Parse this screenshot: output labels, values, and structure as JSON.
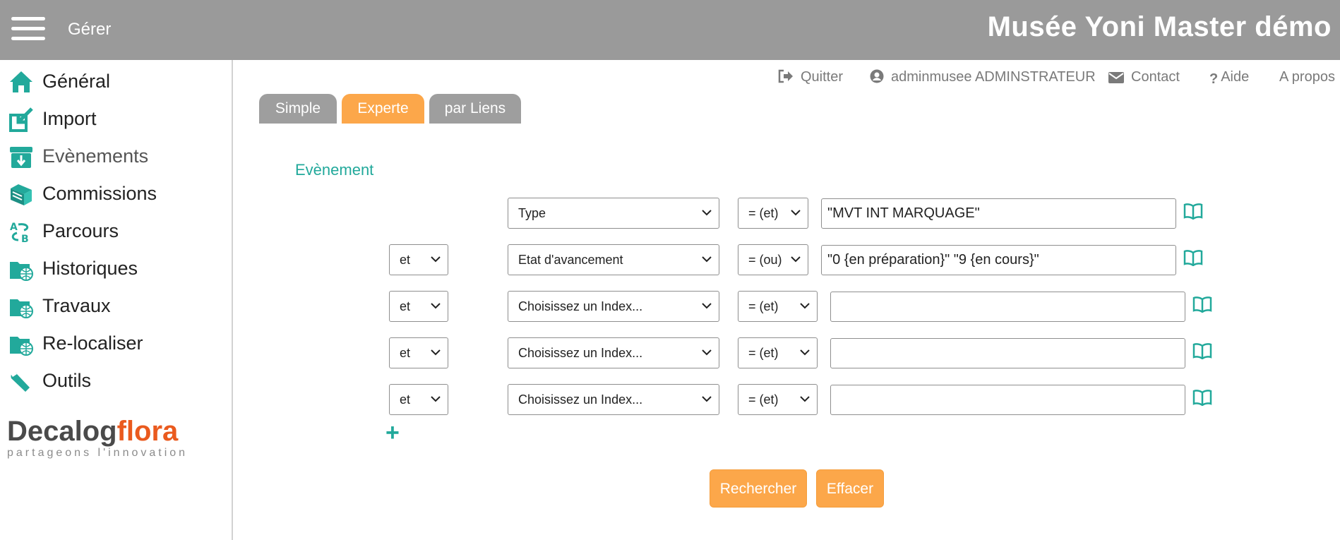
{
  "header": {
    "manage_label": "Gérer",
    "title": "Musée Yoni Master démo"
  },
  "sidebar": {
    "items": [
      {
        "label": "Général",
        "icon": "home-icon"
      },
      {
        "label": "Import",
        "icon": "import-icon"
      },
      {
        "label": "Evènements",
        "icon": "event-archive-icon"
      },
      {
        "label": "Commissions",
        "icon": "books-icon"
      },
      {
        "label": "Parcours",
        "icon": "route-icon"
      },
      {
        "label": "Historiques",
        "icon": "globe-folder-icon"
      },
      {
        "label": "Travaux",
        "icon": "globe-folder-icon"
      },
      {
        "label": "Re-localiser",
        "icon": "globe-folder-icon"
      },
      {
        "label": "Outils",
        "icon": "wrench-icon"
      }
    ],
    "brand": {
      "decalog": "Decalog",
      "flora": "flora",
      "tagline": "partageons l'innovation"
    }
  },
  "toplinks": {
    "quit": "Quitter",
    "user": "adminmusee ADMINSTRATEUR",
    "contact": "Contact",
    "help": "Aide",
    "about": "A propos"
  },
  "tabs": [
    {
      "label": "Simple",
      "active": false
    },
    {
      "label": "Experte",
      "active": true
    },
    {
      "label": "par Liens",
      "active": false
    }
  ],
  "section": {
    "label": "Evènement"
  },
  "criteria": [
    {
      "connector": "",
      "field": "Type",
      "operator": "= (et)",
      "value": "\"MVT INT MARQUAGE\""
    },
    {
      "connector": "et",
      "field": "Etat d'avancement",
      "operator": "= (ou)",
      "value": "\"0 {en préparation}\" \"9 {en cours}\""
    },
    {
      "connector": "et",
      "field": "Choisissez un Index...",
      "operator": "= (et)",
      "value": ""
    },
    {
      "connector": "et",
      "field": "Choisissez un Index...",
      "operator": "= (et)",
      "value": ""
    },
    {
      "connector": "et",
      "field": "Choisissez un Index...",
      "operator": "= (et)",
      "value": ""
    }
  ],
  "add_label": "+",
  "actions": {
    "search": "Rechercher",
    "clear": "Effacer"
  },
  "colors": {
    "header": "#9a9a9a",
    "accent_orange": "#fca74a",
    "accent_teal": "#22a99b",
    "tab_grey": "#9e9e9e"
  }
}
